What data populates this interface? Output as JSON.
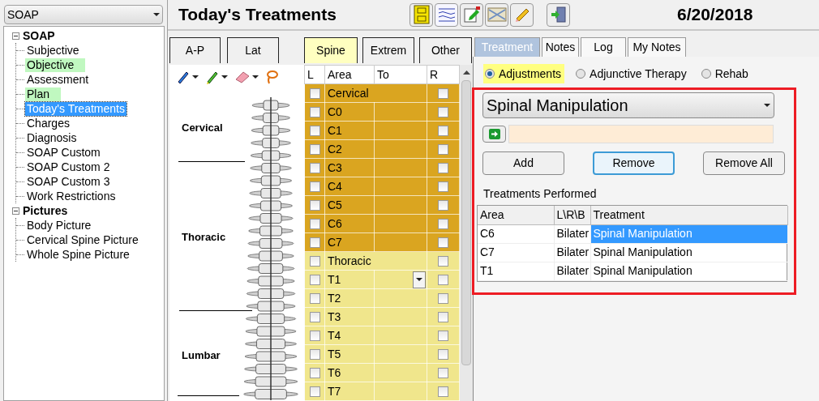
{
  "view_selector": {
    "value": "SOAP"
  },
  "tree": [
    {
      "label": "SOAP",
      "expanded": true,
      "children": [
        {
          "label": "Subjective",
          "highlighted": false,
          "selected": false
        },
        {
          "label": "Objective",
          "highlighted": true,
          "selected": false
        },
        {
          "label": "Assessment",
          "highlighted": false,
          "selected": false
        },
        {
          "label": "Plan",
          "highlighted": true,
          "selected": false
        },
        {
          "label": "Today's Treatments",
          "highlighted": false,
          "selected": true
        },
        {
          "label": "Charges",
          "highlighted": false,
          "selected": false
        },
        {
          "label": "Diagnosis",
          "highlighted": false,
          "selected": false
        },
        {
          "label": "SOAP Custom",
          "highlighted": false,
          "selected": false
        },
        {
          "label": "SOAP Custom 2",
          "highlighted": false,
          "selected": false
        },
        {
          "label": "SOAP Custom 3",
          "highlighted": false,
          "selected": false
        },
        {
          "label": "Work Restrictions",
          "highlighted": false,
          "selected": false
        }
      ]
    },
    {
      "label": "Pictures",
      "expanded": true,
      "children": [
        {
          "label": "Body Picture",
          "highlighted": false,
          "selected": false
        },
        {
          "label": "Cervical Spine Picture",
          "highlighted": false,
          "selected": false
        },
        {
          "label": "Whole Spine Picture",
          "highlighted": false,
          "selected": false
        }
      ]
    }
  ],
  "header": {
    "title": "Today's Treatments",
    "date": "6/20/2018"
  },
  "view_tabs": [
    {
      "label": "A-P",
      "selected": false
    },
    {
      "label": "Lat",
      "selected": false
    }
  ],
  "diagram_labels": [
    "Cervical",
    "Thoracic",
    "Lumbar"
  ],
  "region_tabs": [
    {
      "label": "Spine",
      "selected": true
    },
    {
      "label": "Extrem",
      "selected": false
    },
    {
      "label": "Other",
      "selected": false
    }
  ],
  "segment_grid": {
    "columns": [
      "L",
      "Area",
      "To",
      "R"
    ],
    "rows": [
      {
        "area": "Cervical",
        "color": "#daa520",
        "left_checked": false,
        "right_checked": false,
        "to_dropdown": false,
        "group_header": true
      },
      {
        "area": "C0",
        "color": "#daa520",
        "left_checked": false,
        "right_checked": false,
        "to_dropdown": false,
        "group_header": false
      },
      {
        "area": "C1",
        "color": "#daa520",
        "left_checked": false,
        "right_checked": false,
        "to_dropdown": false,
        "group_header": false
      },
      {
        "area": "C2",
        "color": "#daa520",
        "left_checked": false,
        "right_checked": false,
        "to_dropdown": false,
        "group_header": false
      },
      {
        "area": "C3",
        "color": "#daa520",
        "left_checked": false,
        "right_checked": false,
        "to_dropdown": false,
        "group_header": false
      },
      {
        "area": "C4",
        "color": "#daa520",
        "left_checked": false,
        "right_checked": false,
        "to_dropdown": false,
        "group_header": false
      },
      {
        "area": "C5",
        "color": "#daa520",
        "left_checked": false,
        "right_checked": false,
        "to_dropdown": false,
        "group_header": false
      },
      {
        "area": "C6",
        "color": "#daa520",
        "left_checked": false,
        "right_checked": false,
        "to_dropdown": false,
        "group_header": false
      },
      {
        "area": "C7",
        "color": "#daa520",
        "left_checked": false,
        "right_checked": false,
        "to_dropdown": false,
        "group_header": false
      },
      {
        "area": "Thoracic",
        "color": "#f0e68c",
        "left_checked": false,
        "right_checked": false,
        "to_dropdown": false,
        "group_header": true
      },
      {
        "area": "T1",
        "color": "#f0e68c",
        "left_checked": false,
        "right_checked": false,
        "to_dropdown": true,
        "group_header": false
      },
      {
        "area": "T2",
        "color": "#f0e68c",
        "left_checked": false,
        "right_checked": false,
        "to_dropdown": false,
        "group_header": false
      },
      {
        "area": "T3",
        "color": "#f0e68c",
        "left_checked": false,
        "right_checked": false,
        "to_dropdown": false,
        "group_header": false
      },
      {
        "area": "T4",
        "color": "#f0e68c",
        "left_checked": false,
        "right_checked": false,
        "to_dropdown": false,
        "group_header": false
      },
      {
        "area": "T5",
        "color": "#f0e68c",
        "left_checked": false,
        "right_checked": false,
        "to_dropdown": false,
        "group_header": false
      },
      {
        "area": "T6",
        "color": "#f0e68c",
        "left_checked": false,
        "right_checked": false,
        "to_dropdown": false,
        "group_header": false
      },
      {
        "area": "T7",
        "color": "#f0e68c",
        "left_checked": false,
        "right_checked": false,
        "to_dropdown": false,
        "group_header": false
      }
    ]
  },
  "detail_tabs": [
    {
      "label": "Treatment",
      "selected": true
    },
    {
      "label": "Notes",
      "selected": false
    },
    {
      "label": "Log",
      "selected": false
    },
    {
      "label": "My Notes",
      "selected": false
    }
  ],
  "treatment_types": [
    {
      "label": "Adjustments",
      "selected": true
    },
    {
      "label": "Adjunctive Therapy",
      "selected": false
    },
    {
      "label": "Rehab",
      "selected": false
    }
  ],
  "treatment_select": {
    "value": "Spinal Manipulation"
  },
  "buttons": [
    {
      "label": "Add",
      "focused": false
    },
    {
      "label": "Remove",
      "focused": true
    },
    {
      "label": "Remove All",
      "focused": false
    }
  ],
  "performed": {
    "title": "Treatments Performed",
    "columns": [
      "Area",
      "L\\R\\B",
      "Treatment"
    ],
    "rows": [
      {
        "area": "C6",
        "side": "Bilater",
        "treatment": "Spinal Manipulation",
        "selected": true
      },
      {
        "area": "C7",
        "side": "Bilater",
        "treatment": "Spinal Manipulation",
        "selected": false
      },
      {
        "area": "T1",
        "side": "Bilater",
        "treatment": "Spinal Manipulation",
        "selected": false
      }
    ]
  }
}
